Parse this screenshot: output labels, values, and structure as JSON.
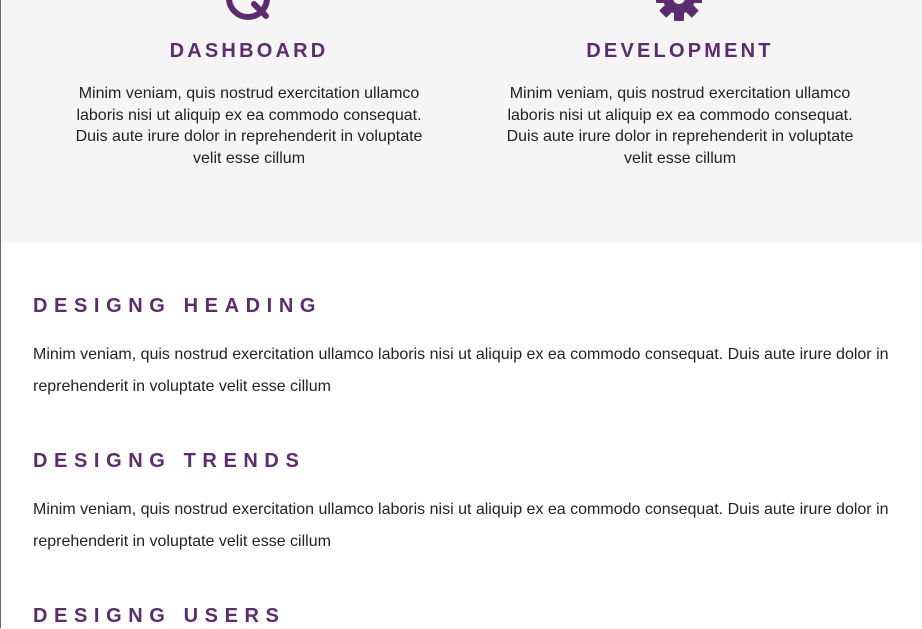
{
  "colors": {
    "accent": "#5b2d6f",
    "panel_background": "#f5f5f5",
    "text": "#222222"
  },
  "features": [
    {
      "icon": "search-icon",
      "title": "DASHBOARD",
      "text": "Minim veniam, quis nostrud exercitation ullamco laboris nisi ut aliquip ex ea commodo consequat. Duis aute irure dolor in reprehenderit in voluptate velit esse cillum"
    },
    {
      "icon": "gear-icon",
      "title": "DEVELOPMENT",
      "text": "Minim veniam, quis nostrud exercitation ullamco laboris nisi ut aliquip ex ea commodo consequat. Duis aute irure dolor in reprehenderit in voluptate velit esse cillum"
    }
  ],
  "sections": [
    {
      "heading": "DESIGNG HEADING",
      "text": "Minim veniam, quis nostrud exercitation ullamco laboris nisi ut aliquip ex ea commodo consequat. Duis aute irure dolor in reprehenderit in voluptate velit esse cillum"
    },
    {
      "heading": "DESIGNG TRENDS",
      "text": "Minim veniam, quis nostrud exercitation ullamco laboris nisi ut aliquip ex ea commodo consequat. Duis aute irure dolor in reprehenderit in voluptate velit esse cillum"
    },
    {
      "heading": "DESIGNG USERS"
    }
  ]
}
